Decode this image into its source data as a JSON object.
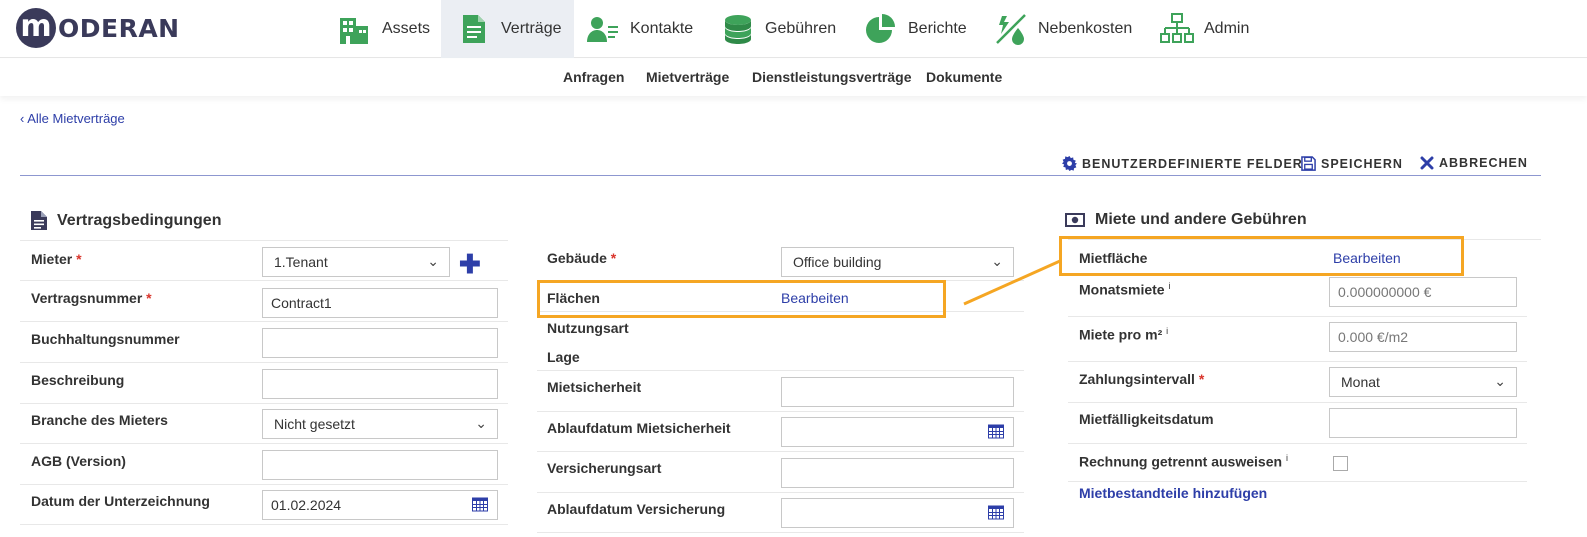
{
  "brand": {
    "logo_letter": "m",
    "name": "ODERAN"
  },
  "nav": [
    {
      "label": "Assets",
      "icon": "building-icon"
    },
    {
      "label": "Verträge",
      "icon": "document-icon",
      "active": true
    },
    {
      "label": "Kontakte",
      "icon": "contact-card-icon"
    },
    {
      "label": "Gebühren",
      "icon": "coins-icon"
    },
    {
      "label": "Berichte",
      "icon": "pie-chart-icon"
    },
    {
      "label": "Nebenkosten",
      "icon": "utilities-icon"
    },
    {
      "label": "Admin",
      "icon": "org-chart-icon"
    }
  ],
  "subnav": [
    "Anfragen",
    "Mietverträge",
    "Dienstleistungsverträge",
    "Dokumente"
  ],
  "back_link": "‹ Alle Mietverträge",
  "toolbar": {
    "custom_fields": "BENUTZERDEFINIERTE FELDER",
    "save": "SPEICHERN",
    "cancel": "ABBRECHEN"
  },
  "colors": {
    "accent": "#2d3ea8",
    "nav_icon_green": "#3ea35a",
    "highlight": "#f5a623",
    "required": "#d9342b"
  },
  "left_section": {
    "title": "Vertragsbedingungen",
    "fields": {
      "tenant": {
        "label": "Mieter",
        "required": "*",
        "value": "1.Tenant"
      },
      "contract_no": {
        "label": "Vertragsnummer",
        "required": "*",
        "value": "Contract1"
      },
      "accounting_no": {
        "label": "Buchhaltungsnummer",
        "value": ""
      },
      "description": {
        "label": "Beschreibung",
        "value": ""
      },
      "industry": {
        "label": "Branche des Mieters",
        "value": "Nicht gesetzt"
      },
      "terms_version": {
        "label": "AGB (Version)",
        "value": ""
      },
      "signing_date": {
        "label": "Datum der Unterzeichnung",
        "value": "01.02.2024"
      }
    }
  },
  "middle_section": {
    "fields": {
      "building": {
        "label": "Gebäude",
        "required": "*",
        "value": "Office building"
      },
      "areas": {
        "label": "Flächen",
        "link": "Bearbeiten"
      },
      "usage_type": {
        "label": "Nutzungsart"
      },
      "location": {
        "label": "Lage"
      },
      "deposit": {
        "label": "Mietsicherheit",
        "value": ""
      },
      "deposit_expiry": {
        "label": "Ablaufdatum Mietsicherheit",
        "value": ""
      },
      "insurance_type": {
        "label": "Versicherungsart",
        "value": ""
      },
      "insurance_expiry": {
        "label": "Ablaufdatum Versicherung",
        "value": ""
      }
    }
  },
  "right_section": {
    "title": "Miete und andere Gebühren",
    "fields": {
      "rental_area": {
        "label": "Mietfläche",
        "link": "Bearbeiten"
      },
      "monthly_rent": {
        "label": "Monatsmiete",
        "info": "i",
        "placeholder": "0.000000000 €"
      },
      "rent_per_sqm": {
        "label": "Miete pro m²",
        "info": "i",
        "placeholder": "0.000 €/m2"
      },
      "payment_interval": {
        "label": "Zahlungsintervall",
        "required": "*",
        "value": "Monat"
      },
      "rent_due_date": {
        "label": "Mietfälligkeitsdatum",
        "value": ""
      },
      "separate_invoice": {
        "label": "Rechnung getrennt ausweisen",
        "info": "i"
      }
    },
    "add_components_link": "Mietbestandteile hinzufügen"
  }
}
